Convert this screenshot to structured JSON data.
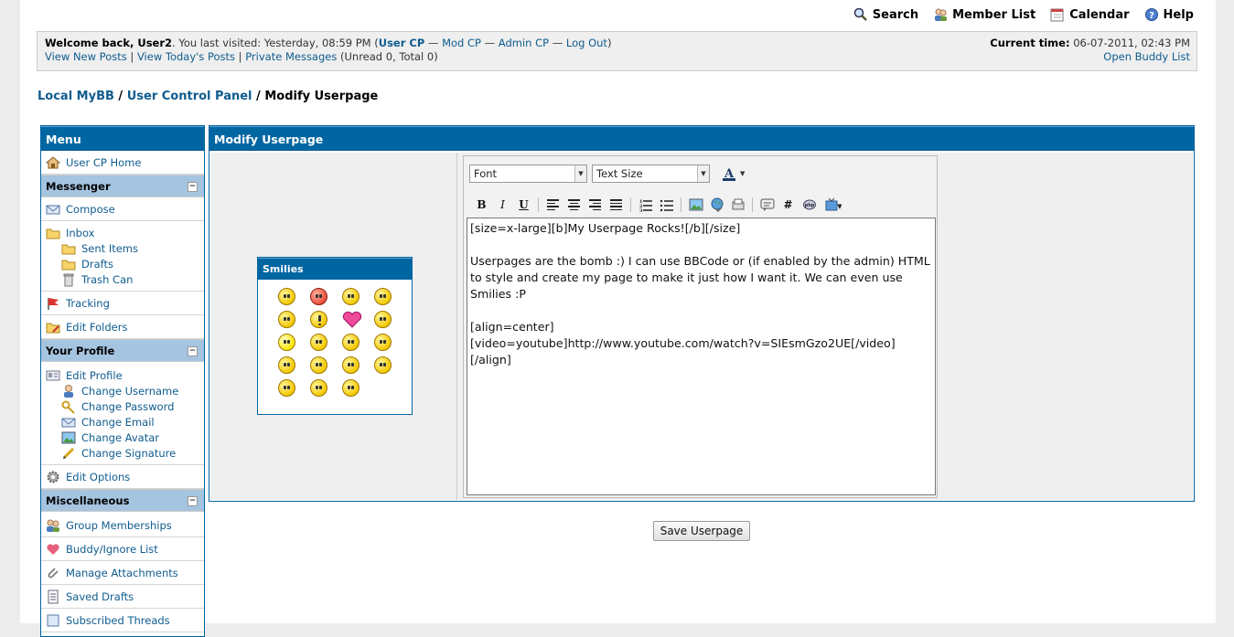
{
  "toplinks": {
    "search": "Search",
    "memberlist": "Member List",
    "calendar": "Calendar",
    "help": "Help"
  },
  "welcome": {
    "prefix": "Welcome back, User2",
    "visited": ". You last visited: Yesterday, 08:59 PM (",
    "user_cp": "User CP",
    "dash": " — ",
    "mod_cp": "Mod CP",
    "admin_cp": "Admin CP",
    "logout": "Log Out",
    "close_paren": ")",
    "new_posts": "View New Posts",
    "sep": " | ",
    "todays_posts": "View Today's Posts",
    "pms": "Private Messages",
    "pm_counts": " (Unread 0, Total 0)",
    "current_time_label": "Current time:",
    "current_time": " 06-07-2011, 02:43 PM",
    "buddy_list": "Open Buddy List"
  },
  "breadcrumb": {
    "home": "Local MyBB",
    "sep": " / ",
    "ucp": "User Control Panel",
    "current": "Modify Userpage"
  },
  "menu": {
    "title": "Menu",
    "ucp_home": "User CP Home",
    "messenger": "Messenger",
    "compose": "Compose",
    "inbox": "Inbox",
    "sent": "Sent Items",
    "drafts": "Drafts",
    "trash": "Trash Can",
    "tracking": "Tracking",
    "edit_folders": "Edit Folders",
    "your_profile": "Your Profile",
    "edit_profile": "Edit Profile",
    "change_username": "Change Username",
    "change_password": "Change Password",
    "change_email": "Change Email",
    "change_avatar": "Change Avatar",
    "change_signature": "Change Signature",
    "edit_options": "Edit Options",
    "misc": "Miscellaneous",
    "group_memberships": "Group Memberships",
    "buddy_ignore": "Buddy/Ignore List",
    "manage_attachments": "Manage Attachments",
    "saved_drafts": "Saved Drafts",
    "subscribed_threads": "Subscribed Threads",
    "collapse": "−"
  },
  "main": {
    "title": "Modify Userpage",
    "smilies_title": "Smilies",
    "font_select": "Font",
    "size_select": "Text Size",
    "message": "[size=x-large][b]My Userpage Rocks![/b][/size]\n\nUserpages are the bomb :) I can use BBCode or (if enabled by the admin) HTML to style and create my page to make it just how I want it. We can even use Smilies :P\n\n[align=center]\n[video=youtube]http://www.youtube.com/watch?v=SIEsmGzo2UE[/video]\n[/align]",
    "save_button": "Save Userpage"
  },
  "toolbar": {
    "bold": "B",
    "italic": "I",
    "underline": "U",
    "hash": "#"
  },
  "colors": {
    "header_blue": "#0066a2",
    "category_blue": "#a5c4e0",
    "link": "#0f5c8e"
  }
}
